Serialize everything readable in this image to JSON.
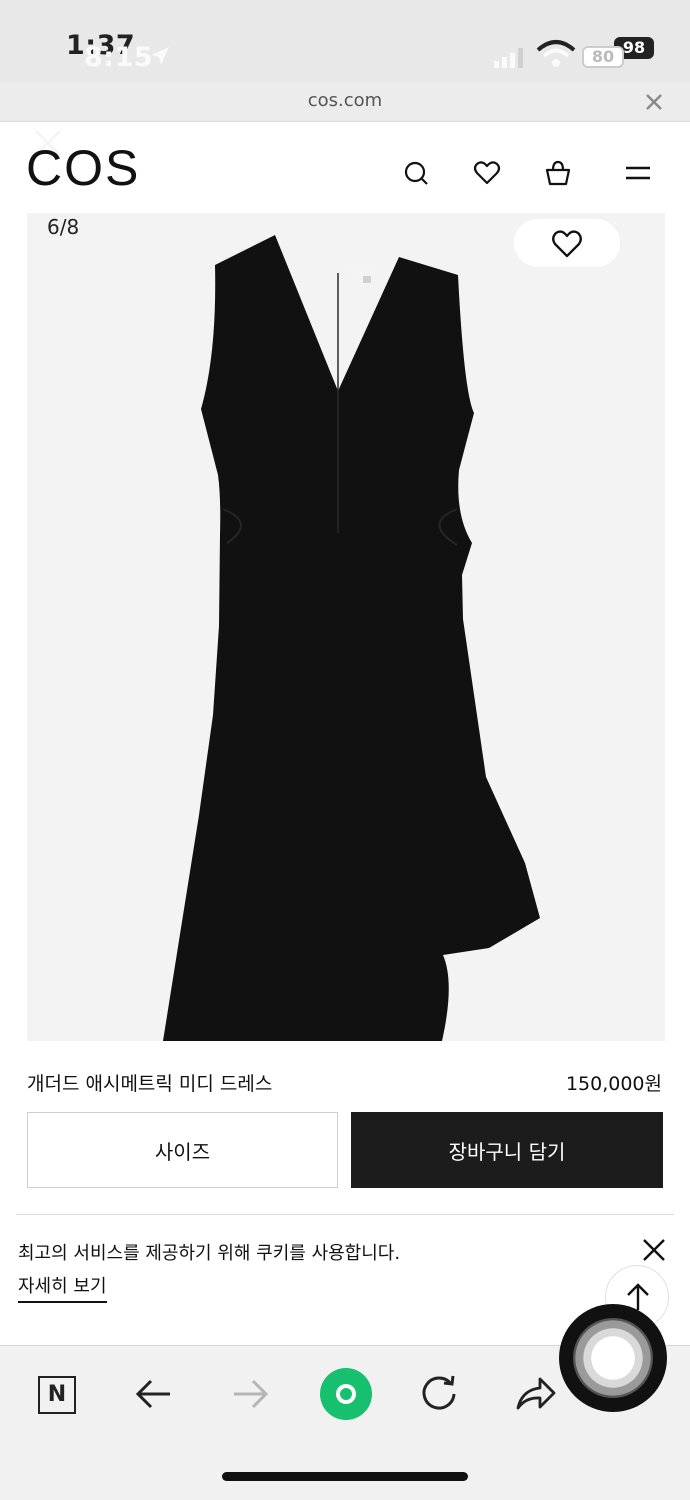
{
  "status_bar": {
    "time": "1:37",
    "time_overlay": "8:15",
    "battery_back": "98",
    "battery_front": "80"
  },
  "browser": {
    "url": "cos.com"
  },
  "site": {
    "logo": "COS"
  },
  "product": {
    "image_counter": "6/8",
    "name": "개더드 애시메트릭 미디 드레스",
    "price": "150,000원",
    "size_button": "사이즈",
    "cart_button": "장바구니 담기"
  },
  "cookie": {
    "message": "최고의 서비스를 제공하기 위해 쿠키를 사용합니다.",
    "link": "자세히 보기"
  },
  "toolbar": {
    "naver_label": "N"
  },
  "icons": {
    "header": [
      "close-icon",
      "search-icon",
      "heart-icon",
      "shopping-bag-icon",
      "menu-icon"
    ],
    "toolbar": [
      "naver-icon",
      "back-arrow-icon",
      "forward-arrow-icon",
      "green-home-icon",
      "reload-icon",
      "share-icon"
    ]
  },
  "colors": {
    "cart_button_bg": "#1c1c1c",
    "naver_green": "#16c06e",
    "image_bg": "#f3f3f3"
  }
}
